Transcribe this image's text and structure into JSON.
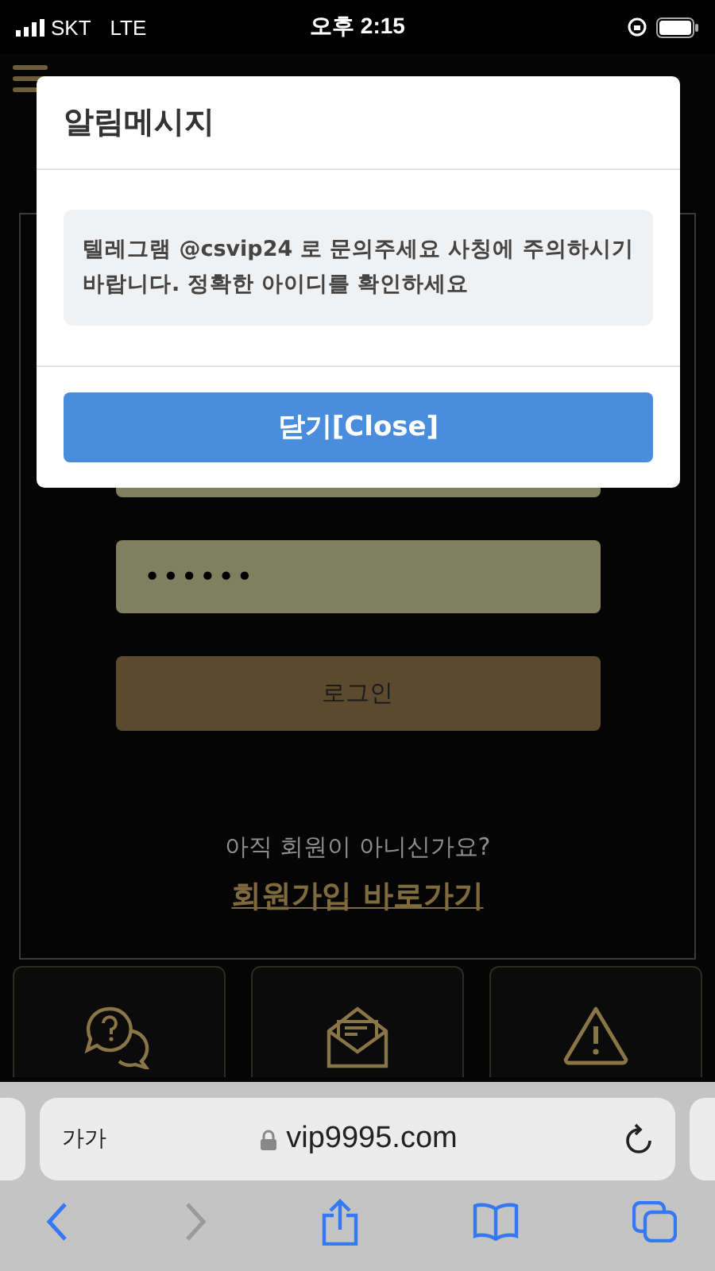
{
  "status_bar": {
    "carrier": "SKT",
    "network": "LTE",
    "time": "오후 2:15"
  },
  "dialog": {
    "title": "알림메시지",
    "message": "텔레그램 @csvip24 로 문의주세요 사칭에 주의하시기 바랍니다. 정확한 아이디를 확인하세요",
    "button": "닫기[Close]"
  },
  "login": {
    "password_value": "••••••",
    "login_button": "로그인",
    "signup_prompt": "아직 회원이 아니신가요?",
    "signup_link": "회원가입 바로가기"
  },
  "cards": [
    {
      "kind": "help"
    },
    {
      "kind": "mail"
    },
    {
      "kind": "warning"
    }
  ],
  "browser": {
    "text_size_button": "가가",
    "url": "vip9995.com",
    "toolbar": [
      {
        "kind": "back",
        "disabled": false
      },
      {
        "kind": "forward",
        "disabled": true
      },
      {
        "kind": "share",
        "disabled": false
      },
      {
        "kind": "bookmarks",
        "disabled": false
      },
      {
        "kind": "tabs",
        "disabled": false
      }
    ]
  }
}
